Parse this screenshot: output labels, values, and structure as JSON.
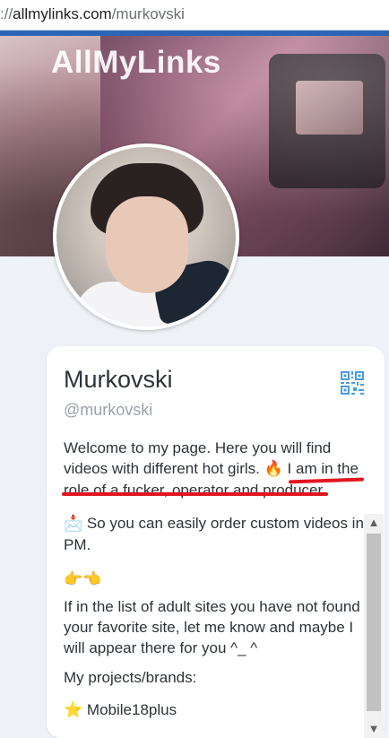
{
  "browser": {
    "url_prefix": "://",
    "url_host": "allmylinks.com",
    "url_path": "/murkovski"
  },
  "banner": {
    "logo_text": "AllMyLinks"
  },
  "profile": {
    "name": "Murkovski",
    "handle": "@murkovski",
    "bio": {
      "line1": "Welcome to my page. Here you will find videos with different hot girls. ",
      "fire_emoji": "🔥",
      "highlight": "I am in the role of a fucker, operator and producer",
      "line1_end": ".",
      "order_emoji": "📩",
      "order_text": "So you can easily order custom videos in PM.",
      "point_emojis": "👉👈",
      "sites_text": "If in the list of adult sites you have not found your favorite site, let me know and maybe I will appear there for you ^_ ^",
      "projects_label": "My projects/brands:",
      "star_emoji": "⭐",
      "brand": "Mobile18plus"
    }
  },
  "icons": {
    "qr": "qr-code-icon",
    "scroll_up": "scroll-up-arrow-icon",
    "scroll_down": "scroll-down-arrow-icon"
  },
  "colors": {
    "accent_blue": "#2c65b5",
    "qr_blue": "#4a9be0",
    "underline_red": "#e1141f",
    "text_dark": "#2d333a",
    "text_muted": "#9aa2ab",
    "page_bg": "#eef2f6"
  }
}
